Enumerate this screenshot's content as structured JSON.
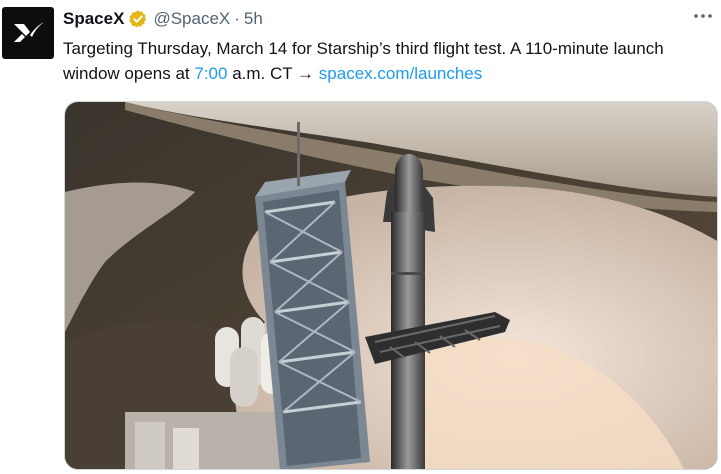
{
  "author": {
    "name": "SpaceX",
    "handle": "@SpaceX",
    "separator": "·",
    "time": "5h",
    "verified_badge_color": "#e2b719"
  },
  "tweet": {
    "text_part1": "Targeting Thursday, March 14 for Starship’s third flight test. A 110-minute launch window opens at ",
    "time_link": "7:00",
    "text_part2": " a.m. CT → ",
    "url": "spacex.com/launches"
  },
  "icons": {
    "avatar": "spacex-x-logo",
    "badge": "verified-badge",
    "more": "more-options-icon"
  },
  "colors": {
    "link": "#1d9bf0",
    "secondary_text": "#536471"
  }
}
